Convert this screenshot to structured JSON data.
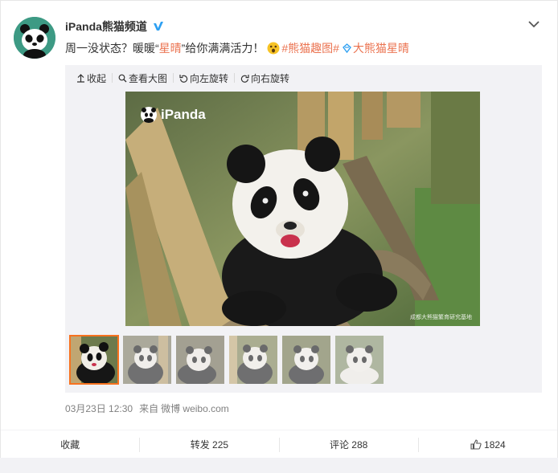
{
  "post": {
    "username": "iPanda熊猫频道",
    "text_before": "周一没状态？暖暖“",
    "highlight_name": "星晴",
    "text_after": "”给你满满活力！",
    "topic": "#熊猫趣图#",
    "mention_prefix": "大熊猫",
    "mention_name": "星晴",
    "icons": {
      "verified": "verified-badge-icon",
      "menu": "chevron-down-icon",
      "emoji": "surprised-emoji-icon"
    }
  },
  "toolbar": {
    "collapse": "收起",
    "view_large": "查看大图",
    "rotate_left": "向左旋转",
    "rotate_right": "向右旋转"
  },
  "photo": {
    "watermark": "iPanda",
    "corner_caption": "成都大熊猫繁育研究基地"
  },
  "thumbnails": {
    "count": 6,
    "active_index": 0
  },
  "meta": {
    "timestamp": "03月23日 12:30",
    "source_prefix": "来自",
    "source": "微博 weibo.com"
  },
  "actions": {
    "favorite": "收藏",
    "repost": "转发 225",
    "comment": "评论 288",
    "like": "1824"
  },
  "colors": {
    "accent": "#eb7350",
    "thumb_active": "#f7721f",
    "verified": "#2ea0f2",
    "avatar_bg": "#3d9a84"
  }
}
